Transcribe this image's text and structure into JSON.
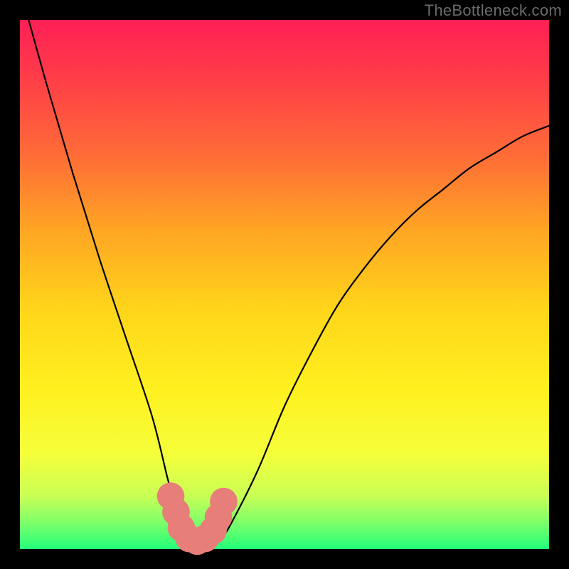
{
  "watermark": "TheBottleneck.com",
  "chart_data": {
    "type": "line",
    "title": "",
    "xlabel": "",
    "ylabel": "",
    "xlim": [
      0,
      100
    ],
    "ylim": [
      0,
      100
    ],
    "curve": {
      "name": "bottleneck-curve",
      "x": [
        0,
        5,
        10,
        15,
        20,
        25,
        28,
        30,
        32,
        34,
        36,
        38,
        40,
        45,
        50,
        55,
        60,
        65,
        70,
        75,
        80,
        85,
        90,
        95,
        100
      ],
      "y": [
        106,
        88,
        71,
        55,
        40,
        25,
        13,
        6,
        2,
        1,
        1,
        2,
        5,
        15,
        27,
        37,
        46,
        53,
        59,
        64,
        68,
        72,
        75,
        78,
        80
      ]
    },
    "markers": {
      "name": "highlight-dots",
      "x": [
        28.5,
        29.5,
        30.5,
        32.0,
        33.5,
        35.0,
        36.5,
        37.5,
        38.5
      ],
      "y": [
        10.0,
        7.0,
        4.0,
        2.0,
        1.5,
        2.0,
        3.5,
        6.0,
        9.0
      ],
      "r": 2.6,
      "color": "#e77e7a"
    },
    "gradient_stops": [
      {
        "offset": 0.0,
        "color": "#ff1f55"
      },
      {
        "offset": 0.1,
        "color": "#ff3a49"
      },
      {
        "offset": 0.25,
        "color": "#ff6a38"
      },
      {
        "offset": 0.4,
        "color": "#ffa623"
      },
      {
        "offset": 0.55,
        "color": "#ffd61a"
      },
      {
        "offset": 0.7,
        "color": "#fff020"
      },
      {
        "offset": 0.82,
        "color": "#f5ff3a"
      },
      {
        "offset": 0.9,
        "color": "#c8ff55"
      },
      {
        "offset": 0.95,
        "color": "#7dff6a"
      },
      {
        "offset": 1.0,
        "color": "#23ff7a"
      }
    ]
  }
}
